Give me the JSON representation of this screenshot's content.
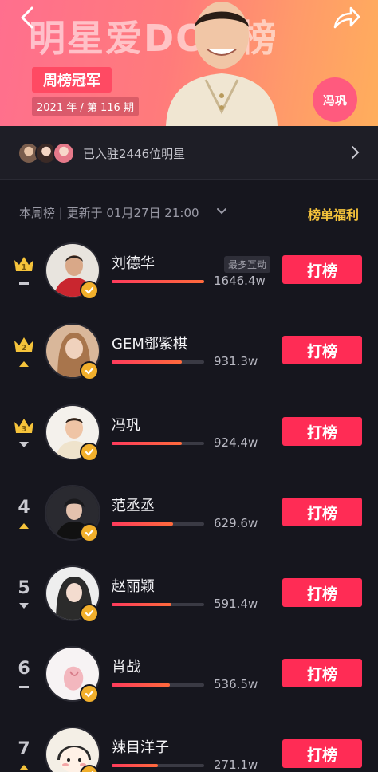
{
  "banner": {
    "title": "明星爱DOU榜",
    "champion_label": "周榜冠军",
    "issue": "2021 年 / 第 116 期",
    "star_name": "冯巩"
  },
  "joined": {
    "text": "已入驻2446位明星"
  },
  "list_header": {
    "period_text": "本周榜 | 更新于 01月27日 21:00",
    "benefit_label": "榜单福利"
  },
  "rankings": [
    {
      "rank": "1",
      "name": "刘德华",
      "score": "1646.4w",
      "progress": 1.0,
      "trend": "flat",
      "badge": "最多互动",
      "vote_label": "打榜"
    },
    {
      "rank": "2",
      "name": "GEM鄧紫棋",
      "score": "931.3w",
      "progress": 0.76,
      "trend": "up",
      "vote_label": "打榜"
    },
    {
      "rank": "3",
      "name": "冯巩",
      "score": "924.4w",
      "progress": 0.76,
      "trend": "down",
      "vote_label": "打榜"
    },
    {
      "rank": "4",
      "name": "范丞丞",
      "score": "629.6w",
      "progress": 0.66,
      "trend": "up",
      "vote_label": "打榜"
    },
    {
      "rank": "5",
      "name": "赵丽颖",
      "score": "591.4w",
      "progress": 0.65,
      "trend": "down",
      "vote_label": "打榜"
    },
    {
      "rank": "6",
      "name": "肖战",
      "score": "536.5w",
      "progress": 0.63,
      "trend": "flat",
      "vote_label": "打榜"
    },
    {
      "rank": "7",
      "name": "辣目洋子",
      "score": "271.1w",
      "progress": 0.5,
      "trend": "up",
      "vote_label": "打榜"
    }
  ],
  "colors": {
    "accent": "#ff2c55",
    "gold": "#f5c33b",
    "background": "#16161e"
  }
}
